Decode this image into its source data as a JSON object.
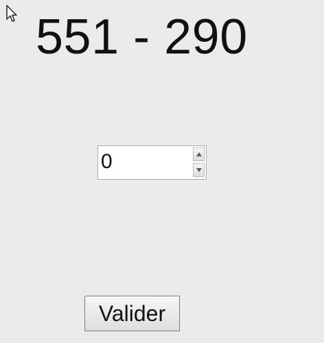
{
  "exercise": {
    "equation": "551 - 290"
  },
  "answer": {
    "value": "0"
  },
  "actions": {
    "validate_label": "Valider"
  },
  "icons": {
    "cursor": "mouse-pointer-icon",
    "spin_up": "arrow-up-icon",
    "spin_down": "arrow-down-icon"
  }
}
